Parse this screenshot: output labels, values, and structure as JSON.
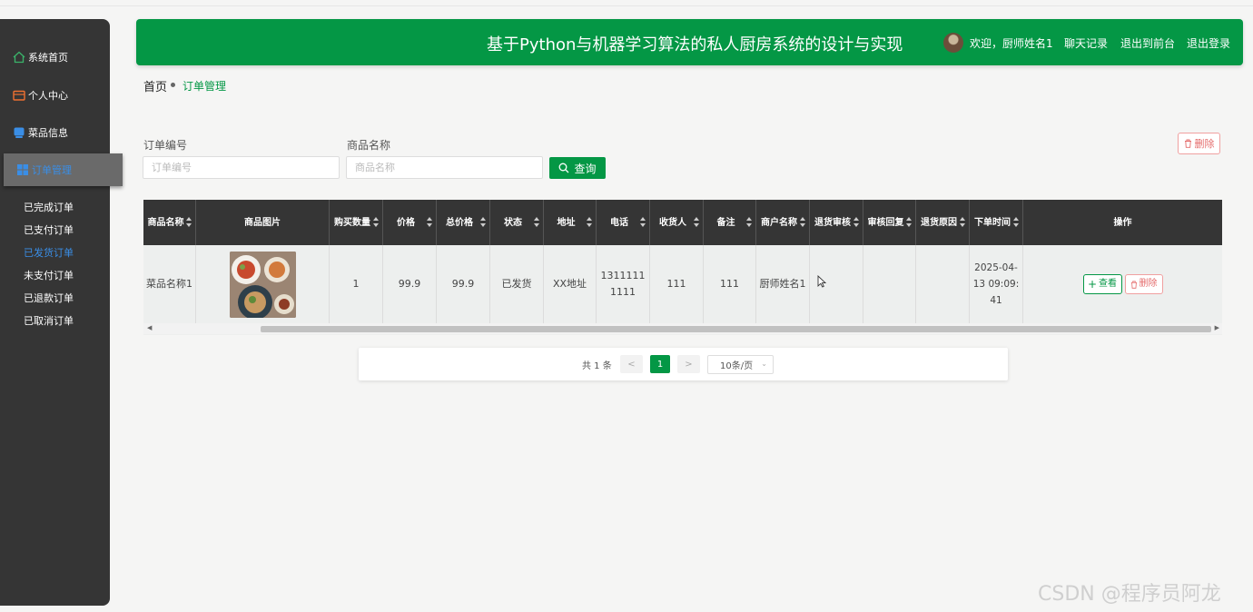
{
  "sidebar": {
    "menu": [
      {
        "label": "系统首页",
        "icon": "home-icon"
      },
      {
        "label": "个人中心",
        "icon": "wallet-icon"
      },
      {
        "label": "菜品信息",
        "icon": "dish-icon"
      },
      {
        "label": "订单管理",
        "icon": "grid-icon"
      }
    ],
    "submenu": [
      "已完成订单",
      "已支付订单",
      "已发货订单",
      "未支付订单",
      "已退款订单",
      "已取消订单"
    ]
  },
  "header": {
    "title": "基于Python与机器学习算法的私人厨房系统的设计与实现",
    "welcome": "欢迎，厨师姓名1",
    "chat": "聊天记录",
    "front": "退出到前台",
    "logout": "退出登录"
  },
  "breadcrumb": {
    "home": "首页",
    "current": "订单管理"
  },
  "search": {
    "order_no_label": "订单编号",
    "order_no_placeholder": "订单编号",
    "product_label": "商品名称",
    "product_placeholder": "商品名称",
    "query_label": "查询",
    "delete_label": "删除"
  },
  "table": {
    "columns": [
      "商品名称",
      "商品图片",
      "购买数量",
      "价格",
      "总价格",
      "状态",
      "地址",
      "电话",
      "收货人",
      "备注",
      "商户名称",
      "退货审核",
      "审核回复",
      "退货原因",
      "下单时间",
      "操作"
    ],
    "rows": [
      {
        "product_name": "菜品名称1",
        "quantity": "1",
        "price": "99.9",
        "total": "99.9",
        "status": "已发货",
        "address": "XX地址",
        "phone": "13111111111",
        "receiver": "111",
        "remark": "111",
        "merchant": "厨师姓名1",
        "return_review": "",
        "review_reply": "",
        "return_reason": "",
        "order_time": "2025-04-13 09:09:41",
        "view_label": "查看",
        "delete_label": "删除"
      }
    ]
  },
  "pagination": {
    "total": "共 1 条",
    "prev": "<",
    "current": "1",
    "next": ">",
    "page_size": "10条/页"
  },
  "watermark": "CSDN @程序员阿龙"
}
